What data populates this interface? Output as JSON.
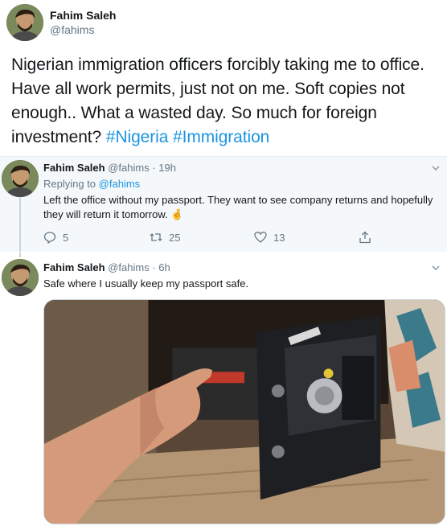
{
  "main_tweet": {
    "author_name": "Fahim Saleh",
    "handle": "@fahims",
    "text": "Nigerian immigration officers forcibly taking me to office. Have all work permits, just not on me. Soft copies not enough.. What a wasted day. So much for foreign investment?",
    "hashtags": [
      "#Nigeria",
      "#Immigration"
    ]
  },
  "replies": [
    {
      "author_name": "Fahim Saleh",
      "handle": "@fahims",
      "time": "· 19h",
      "replying_label": "Replying to",
      "replying_to": "@fahims",
      "text": "Left the office without my passport. They want to see company returns and hopefully they will return it tomorrow.",
      "emoji": "🤞",
      "reply_count": "5",
      "retweet_count": "25",
      "like_count": "13"
    },
    {
      "author_name": "Fahim Saleh",
      "handle": "@fahims",
      "time": "· 6h",
      "text": "Safe where I usually keep my passport safe."
    }
  ],
  "icons": {
    "reply": "reply-icon",
    "retweet": "retweet-icon",
    "like": "heart-icon",
    "share": "share-icon",
    "more": "chevron-down-icon"
  },
  "colors": {
    "link": "#1b95e0",
    "muted": "#657786",
    "highlight_bg": "#f5f8fa",
    "thread_line": "#ccd6dd"
  }
}
